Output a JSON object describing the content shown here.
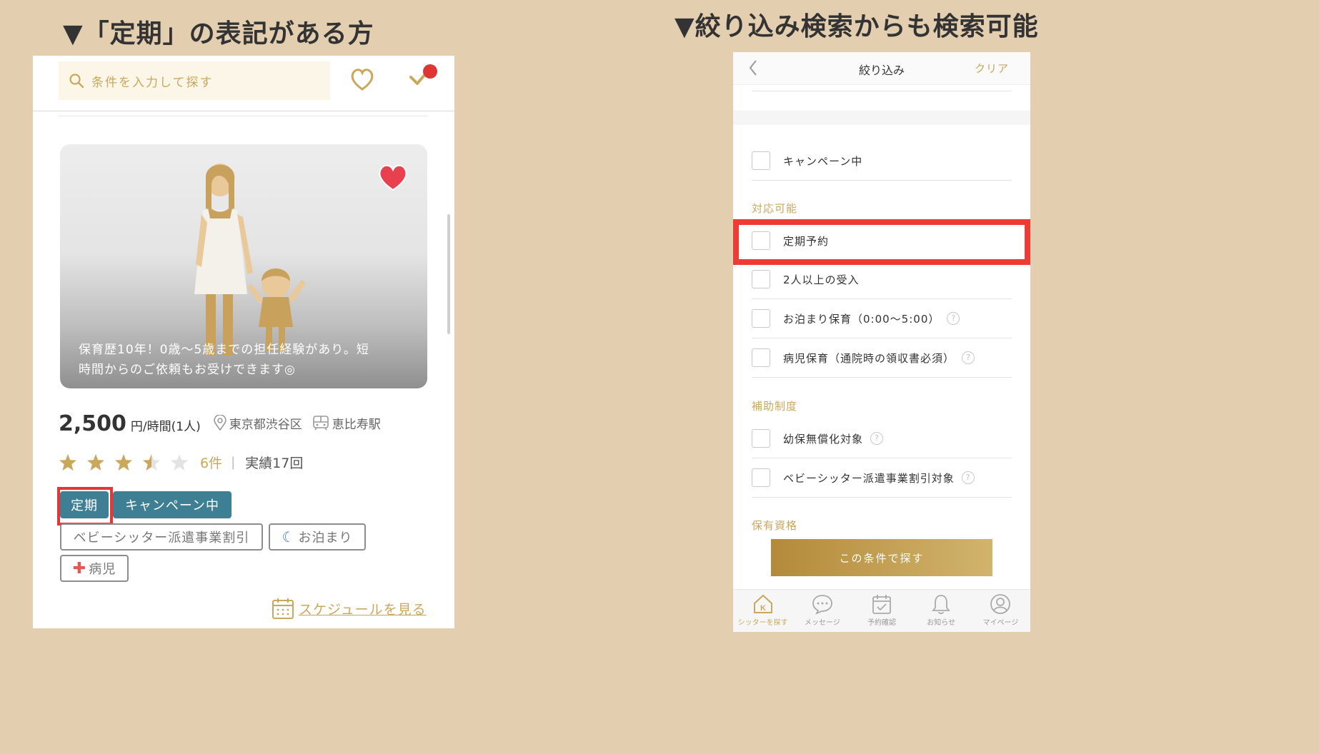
{
  "headings": {
    "left": "▼「定期」の表記がある方",
    "right": "▼絞り込み検索からも検索可能"
  },
  "left_screen": {
    "search_placeholder": "条件を入力して探す",
    "photo_caption_line1": "保育歴10年！0歳～5歳までの担任経験があり。短",
    "photo_caption_line2": "時間からのご依頼もお受けできます◎",
    "price": "2,500",
    "price_unit": "円/時間(1人)",
    "location": "東京都渋谷区",
    "station": "恵比寿駅",
    "rating": 3.5,
    "rating_max": 5,
    "review_count": "6件",
    "separator": "|",
    "achievements": "実績17回",
    "tags": {
      "regular": "定期",
      "campaign": "キャンペーン中",
      "discount": "ベビーシッター派遣事業割引",
      "overnight": "お泊まり",
      "sick": "病児"
    },
    "schedule_link": "スケジュールを見る",
    "colors": {
      "accent_gold": "#c9a85c",
      "tag_teal": "#3f7f93",
      "highlight_red": "#e53535"
    }
  },
  "right_screen": {
    "header": {
      "title": "絞り込み",
      "clear": "クリア"
    },
    "options_top": [
      {
        "label": "キャンペーン中",
        "checked": false
      }
    ],
    "section_available": "対応可能",
    "options_available": [
      {
        "label": "定期予約",
        "checked": false,
        "help": false
      },
      {
        "label": "2人以上の受入",
        "checked": false,
        "help": false
      },
      {
        "label": "お泊まり保育（0:00～5:00）",
        "checked": false,
        "help": true
      },
      {
        "label": "病児保育（通院時の領収書必須）",
        "checked": false,
        "help": true
      }
    ],
    "section_subsidy": "補助制度",
    "options_subsidy": [
      {
        "label": "幼保無償化対象",
        "checked": false,
        "help": true
      },
      {
        "label": "ベビーシッター派遣事業割引対象",
        "checked": false,
        "help": true
      }
    ],
    "section_qualification": "保有資格",
    "help_glyph": "?",
    "cta": "この条件で探す",
    "tabs": [
      {
        "label": "シッターを探す",
        "icon": "house-icon",
        "active": true
      },
      {
        "label": "メッセージ",
        "icon": "chat-icon",
        "active": false
      },
      {
        "label": "予約確認",
        "icon": "calendar-check-icon",
        "active": false
      },
      {
        "label": "お知らせ",
        "icon": "bell-icon",
        "active": false
      },
      {
        "label": "マイページ",
        "icon": "user-icon",
        "active": false
      }
    ]
  }
}
